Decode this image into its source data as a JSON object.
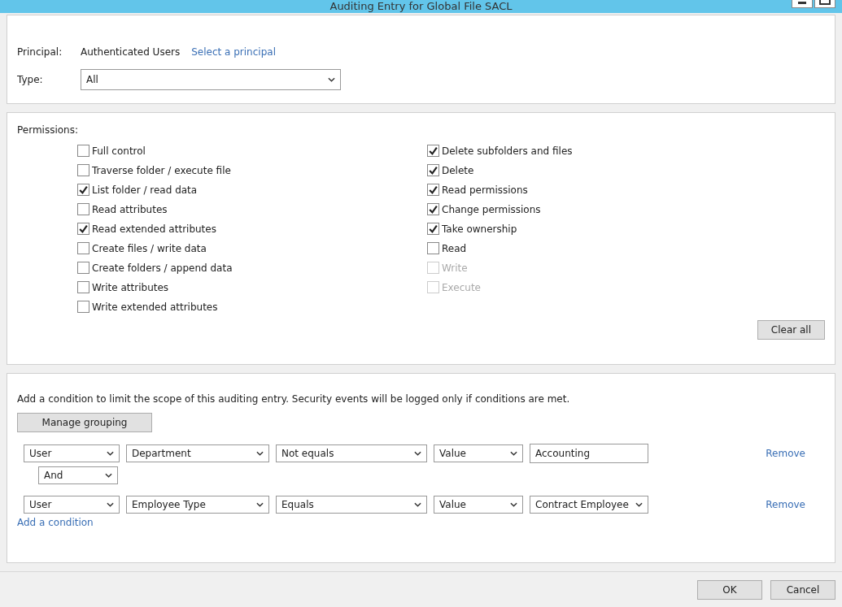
{
  "window": {
    "title": "Auditing Entry for Global File SACL"
  },
  "principal": {
    "label": "Principal:",
    "value": "Authenticated Users",
    "link": "Select a principal"
  },
  "type": {
    "label": "Type:",
    "value": "All"
  },
  "permissions": {
    "label": "Permissions:",
    "left": [
      {
        "label": "Full control",
        "checked": false,
        "disabled": false
      },
      {
        "label": "Traverse folder / execute file",
        "checked": false,
        "disabled": false
      },
      {
        "label": "List folder / read data",
        "checked": true,
        "disabled": false
      },
      {
        "label": "Read attributes",
        "checked": false,
        "disabled": false
      },
      {
        "label": "Read extended attributes",
        "checked": true,
        "disabled": false
      },
      {
        "label": "Create files / write data",
        "checked": false,
        "disabled": false
      },
      {
        "label": "Create folders / append data",
        "checked": false,
        "disabled": false
      },
      {
        "label": "Write attributes",
        "checked": false,
        "disabled": false
      },
      {
        "label": "Write extended attributes",
        "checked": false,
        "disabled": false
      }
    ],
    "right": [
      {
        "label": "Delete subfolders and files",
        "checked": true,
        "disabled": false
      },
      {
        "label": "Delete",
        "checked": true,
        "disabled": false
      },
      {
        "label": "Read permissions",
        "checked": true,
        "disabled": false
      },
      {
        "label": "Change permissions",
        "checked": true,
        "disabled": false
      },
      {
        "label": "Take ownership",
        "checked": true,
        "disabled": false
      },
      {
        "label": "Read",
        "checked": false,
        "disabled": false
      },
      {
        "label": "Write",
        "checked": false,
        "disabled": true
      },
      {
        "label": "Execute",
        "checked": false,
        "disabled": true
      }
    ],
    "clear_button": "Clear all"
  },
  "conditions": {
    "description": "Add a condition to limit the scope of this auditing entry. Security events will be logged only if conditions are met.",
    "manage_button": "Manage grouping",
    "rows": [
      {
        "kind": "condition",
        "fields": [
          {
            "kind": "dropdown",
            "value": "User"
          },
          {
            "kind": "dropdown",
            "value": "Department"
          },
          {
            "kind": "dropdown",
            "value": "Not equals"
          },
          {
            "kind": "dropdown",
            "value": "Value"
          },
          {
            "kind": "text",
            "value": "Accounting"
          }
        ],
        "remove": "Remove"
      },
      {
        "kind": "operator",
        "value": "And"
      },
      {
        "kind": "condition",
        "fields": [
          {
            "kind": "dropdown",
            "value": "User"
          },
          {
            "kind": "dropdown",
            "value": "Employee Type"
          },
          {
            "kind": "dropdown",
            "value": "Equals"
          },
          {
            "kind": "dropdown",
            "value": "Value"
          },
          {
            "kind": "dropdown",
            "value": "Contract Employee"
          }
        ],
        "remove": "Remove"
      }
    ],
    "add_link": "Add a condition"
  },
  "buttons": [
    "OK",
    "Cancel"
  ]
}
